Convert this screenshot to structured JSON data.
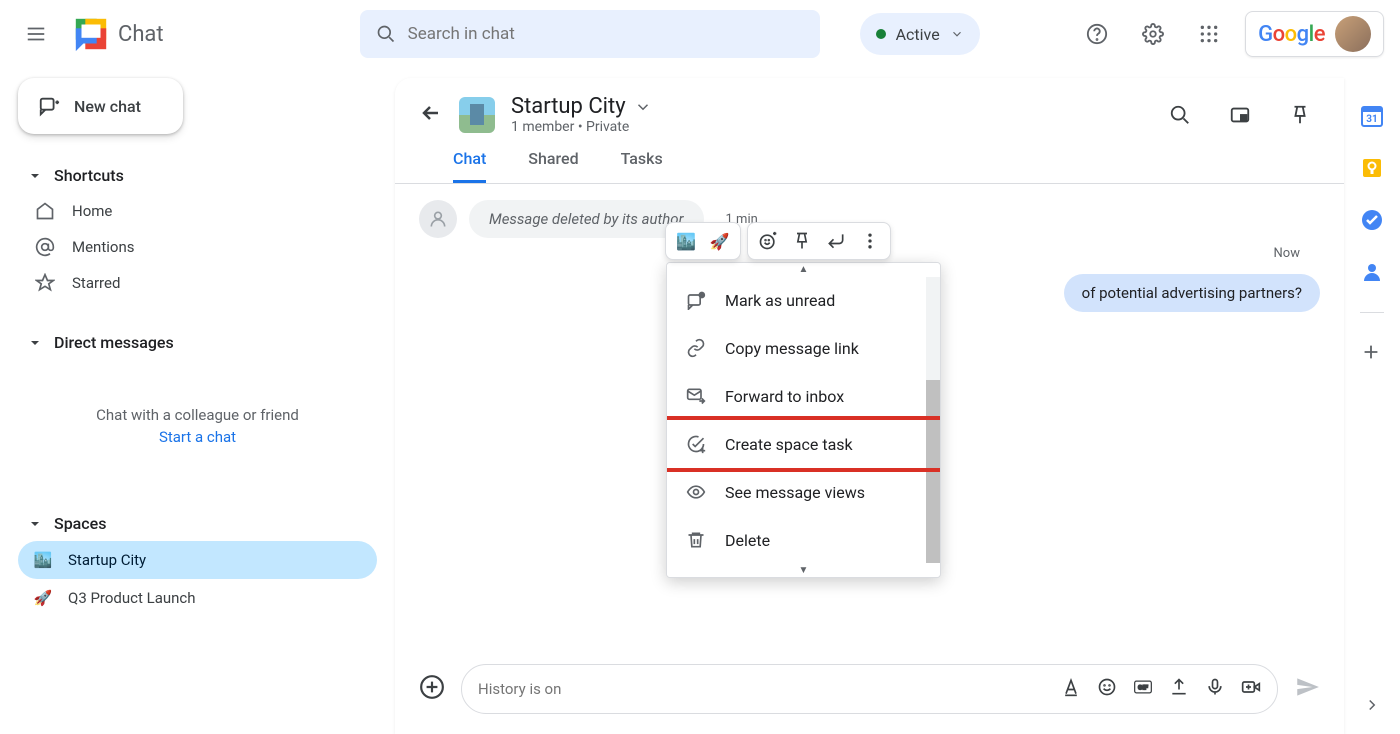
{
  "topbar": {
    "product_name": "Chat",
    "search_placeholder": "Search in chat",
    "status_label": "Active",
    "google_brand": "Google"
  },
  "sidebar": {
    "new_chat_label": "New chat",
    "sections": {
      "shortcuts_label": "Shortcuts",
      "home_label": "Home",
      "mentions_label": "Mentions",
      "starred_label": "Starred",
      "dm_label": "Direct messages",
      "empty_line1": "Chat with a colleague or friend",
      "empty_link": "Start a chat",
      "spaces_label": "Spaces"
    },
    "spaces": [
      {
        "label": "Startup City",
        "active": true
      },
      {
        "label": "Q3 Product Launch",
        "active": false
      }
    ]
  },
  "panel": {
    "title": "Startup City",
    "meta": "1 member  •  Private",
    "tabs": {
      "chat": "Chat",
      "shared": "Shared",
      "tasks": "Tasks"
    }
  },
  "messages": {
    "deleted_text": "Message deleted by its author",
    "deleted_time": "1 min",
    "right_text": "of potential advertising partners?",
    "right_time": "Now"
  },
  "context_menu": {
    "mark_unread": "Mark as unread",
    "copy_link": "Copy message link",
    "forward": "Forward to inbox",
    "create_task": "Create space task",
    "see_views": "See message views",
    "delete": "Delete"
  },
  "compose": {
    "placeholder": "History is on"
  }
}
